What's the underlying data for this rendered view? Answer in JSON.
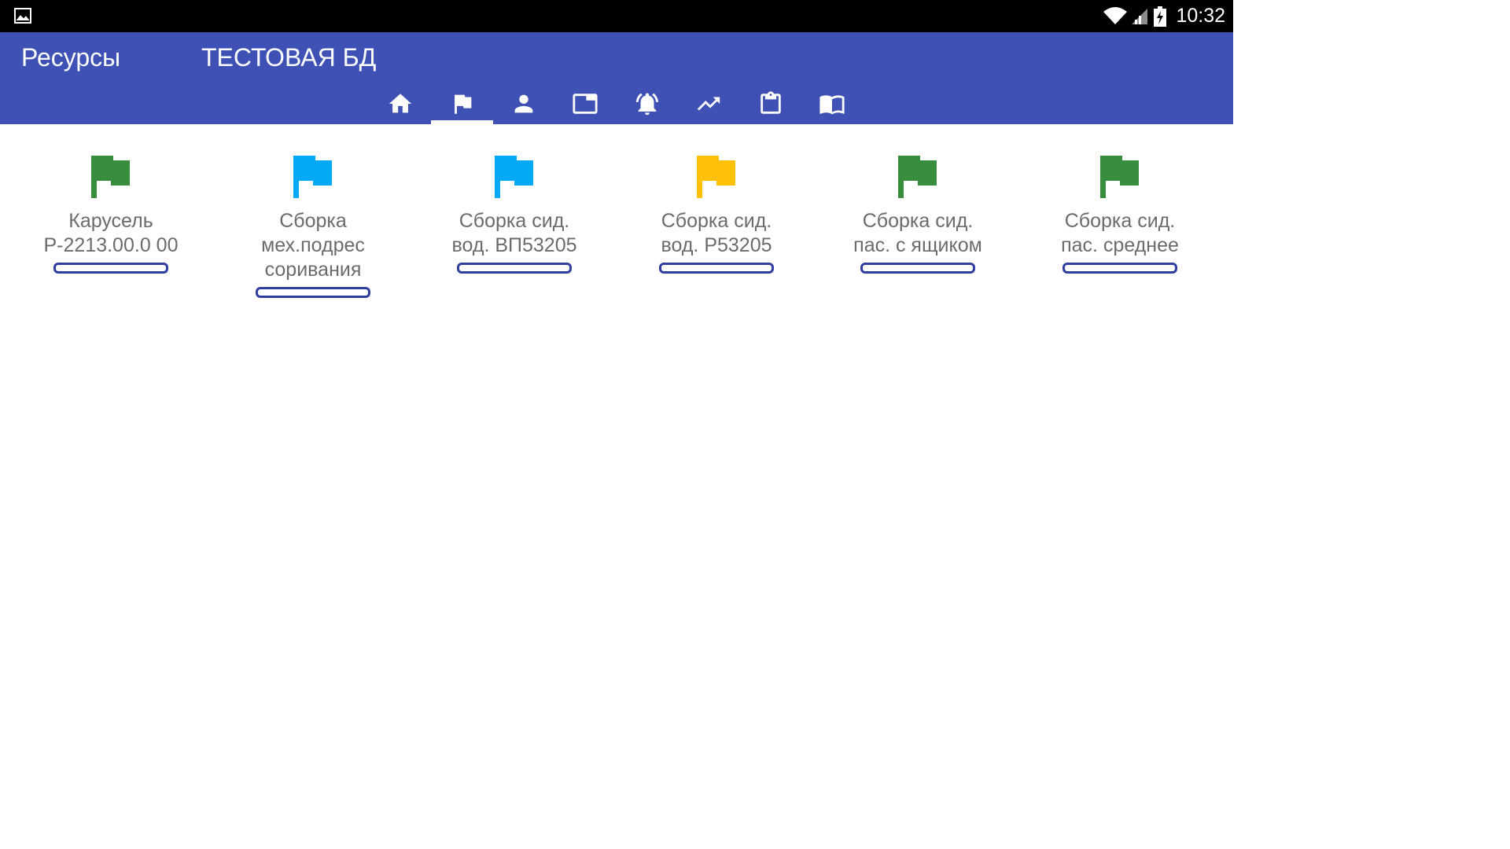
{
  "status_bar": {
    "time": "10:32"
  },
  "app_bar": {
    "title": "Ресурсы",
    "subtitle": "ТЕСТОВАЯ БД"
  },
  "tabs": [
    {
      "icon": "home-icon",
      "active": false
    },
    {
      "icon": "flag-icon",
      "active": true
    },
    {
      "icon": "person-icon",
      "active": false
    },
    {
      "icon": "window-icon",
      "active": false
    },
    {
      "icon": "alarm-bell-icon",
      "active": false
    },
    {
      "icon": "trending-up-icon",
      "active": false
    },
    {
      "icon": "clipboard-icon",
      "active": false
    },
    {
      "icon": "book-icon",
      "active": false
    }
  ],
  "resources": [
    {
      "label": "Карусель Р-2213.00.0 00",
      "flag_color": "#388e3c"
    },
    {
      "label": "Сборка мех.подрес соривания",
      "flag_color": "#03a9f4"
    },
    {
      "label": "Сборка сид. вод. ВП53205",
      "flag_color": "#03a9f4"
    },
    {
      "label": "Сборка сид. вод. Р53205",
      "flag_color": "#ffc107"
    },
    {
      "label": "Сборка сид. пас. с ящиком",
      "flag_color": "#388e3c"
    },
    {
      "label": "Сборка сид. пас. среднее",
      "flag_color": "#388e3c"
    }
  ],
  "colors": {
    "primary": "#3f51b5",
    "accent_dark": "#303f9f",
    "label_text": "#6b6b6b"
  }
}
